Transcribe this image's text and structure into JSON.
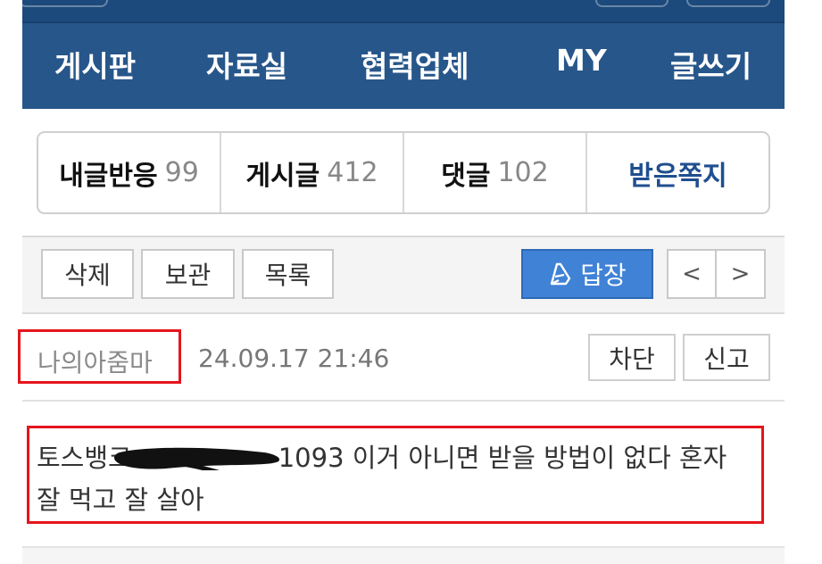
{
  "nav": {
    "items": [
      {
        "label": "게시판"
      },
      {
        "label": "자료실"
      },
      {
        "label": "협력업체"
      },
      {
        "label": "MY"
      },
      {
        "label": "글쓰기"
      }
    ]
  },
  "tabs": [
    {
      "label": "내글반응",
      "count": "99"
    },
    {
      "label": "게시글",
      "count": "412"
    },
    {
      "label": "댓글",
      "count": "102"
    },
    {
      "label": "받은쪽지"
    }
  ],
  "toolbar": {
    "delete_label": "삭제",
    "archive_label": "보관",
    "list_label": "목록",
    "reply_label": "답장",
    "prev_label": "<",
    "next_label": ">"
  },
  "message": {
    "author": "나의아줌마",
    "datetime": "24.09.17 21:46",
    "block_label": "차단",
    "report_label": "신고",
    "body_prefix": "토스뱅크",
    "body_suffix": "1093 이거 아니면 받을 방법이 없다 혼자",
    "body_line2": "잘 먹고 잘 살아"
  },
  "colors": {
    "nav_bg": "#27568a",
    "active_tab": "#1f4f8f",
    "reply_button": "#3f82d6",
    "highlight": "#e5151c"
  }
}
